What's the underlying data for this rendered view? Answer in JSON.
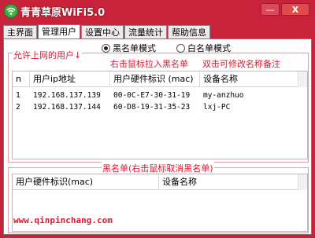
{
  "window": {
    "title": "青青草原WiFi5.0",
    "minimize_label": "—",
    "close_label": "X"
  },
  "tabs": [
    {
      "label": "主界面",
      "active": false
    },
    {
      "label": "管理用户",
      "active": true
    },
    {
      "label": "设置中心",
      "active": false
    },
    {
      "label": "流量统计",
      "active": false
    },
    {
      "label": "帮助信息",
      "active": false
    }
  ],
  "mode": {
    "blacklist_label": "黑名单模式",
    "whitelist_label": "白名单模式",
    "selected": "blacklist"
  },
  "allowed": {
    "title": "允许上网的用户↓",
    "hint_right_click": "右击鼠标拉入黑名单",
    "hint_double_click": "双击可修改名称备注",
    "columns": [
      "n",
      "用户ip地址",
      "用户硬件标识 (mac)",
      "设备名称"
    ],
    "rows": [
      {
        "n": "1",
        "ip": "192.168.137.139",
        "mac": "00-0C-E7-30-31-19",
        "name": "my-anzhuo"
      },
      {
        "n": "2",
        "ip": "192.168.137.144",
        "mac": "60-D8-19-31-35-23",
        "name": "lxj-PC"
      }
    ]
  },
  "blacklist": {
    "title": "黑名单(右击鼠标取消黑名单)",
    "columns": [
      "用户硬件标识(mac)",
      "设备名称"
    ]
  },
  "website": "www.qinpinchang.com",
  "colors": {
    "accent": "#e0162e",
    "frame": "#c8233b"
  }
}
